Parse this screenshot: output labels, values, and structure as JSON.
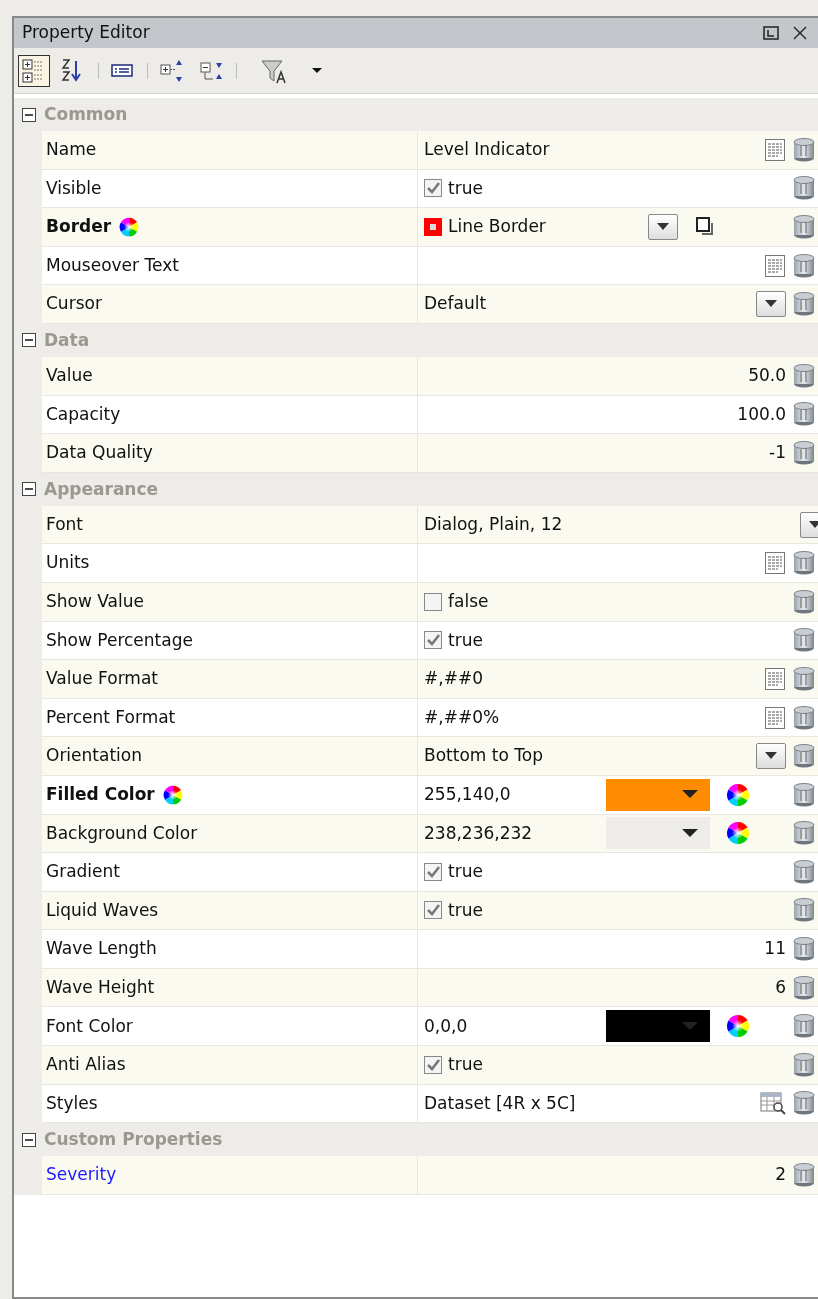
{
  "window": {
    "title": "Property Editor"
  },
  "toolbar": [
    {
      "kind": "categorized",
      "selected": true
    },
    {
      "kind": "sort",
      "selected": false
    },
    {
      "kind": "sep"
    },
    {
      "kind": "description",
      "selected": false
    },
    {
      "kind": "sep"
    },
    {
      "kind": "expand",
      "selected": false
    },
    {
      "kind": "collapse",
      "selected": false
    },
    {
      "kind": "sep"
    },
    {
      "kind": "filter",
      "selected": false
    },
    {
      "kind": "caret",
      "selected": false
    }
  ],
  "sections": [
    {
      "title": "Common",
      "expanded": true,
      "rows": [
        {
          "name": "Name",
          "kind": "text",
          "value": "Level Indicator",
          "editor": true,
          "binding": true
        },
        {
          "name": "Visible",
          "kind": "check",
          "checked": true,
          "value": "true",
          "binding": true
        },
        {
          "name": "Border",
          "kind": "border",
          "value": "Line Border",
          "bound": true,
          "binding": true
        },
        {
          "name": "Mouseover Text",
          "kind": "text",
          "editor": true,
          "binding": true
        },
        {
          "name": "Cursor",
          "kind": "dropdown",
          "value": "Default",
          "binding": true
        }
      ]
    },
    {
      "title": "Data",
      "expanded": true,
      "rows": [
        {
          "name": "Value",
          "kind": "number",
          "value": "50.0",
          "binding": true
        },
        {
          "name": "Capacity",
          "kind": "number",
          "value": "100.0",
          "binding": true
        },
        {
          "name": "Data Quality",
          "kind": "number",
          "value": "-1",
          "binding": true
        }
      ]
    },
    {
      "title": "Appearance",
      "expanded": true,
      "rows": [
        {
          "name": "Font",
          "kind": "dropdown",
          "value": "Dialog, Plain, 12",
          "binding": false
        },
        {
          "name": "Units",
          "kind": "text",
          "editor": true,
          "binding": true
        },
        {
          "name": "Show Value",
          "kind": "check",
          "checked": false,
          "value": "false",
          "binding": true
        },
        {
          "name": "Show Percentage",
          "kind": "check",
          "checked": true,
          "value": "true",
          "binding": true
        },
        {
          "name": "Value Format",
          "kind": "text",
          "value": "#,##0",
          "editor": true,
          "binding": true
        },
        {
          "name": "Percent Format",
          "kind": "text",
          "value": "#,##0%",
          "editor": true,
          "binding": true
        },
        {
          "name": "Orientation",
          "kind": "dropdown",
          "value": "Bottom to Top",
          "binding": true
        },
        {
          "name": "Filled Color",
          "kind": "color",
          "value": "255,140,0",
          "color": "#ff8c00",
          "bound": true,
          "binding": true
        },
        {
          "name": "Background Color",
          "kind": "color",
          "value": "238,236,232",
          "color": "#eeece8",
          "binding": true
        },
        {
          "name": "Gradient",
          "kind": "check",
          "checked": true,
          "value": "true",
          "binding": true
        },
        {
          "name": "Liquid Waves",
          "kind": "check",
          "checked": true,
          "value": "true",
          "binding": true
        },
        {
          "name": "Wave Length",
          "kind": "number",
          "value": "11",
          "binding": true
        },
        {
          "name": "Wave Height",
          "kind": "number",
          "value": "6",
          "binding": true
        },
        {
          "name": "Font Color",
          "kind": "color",
          "value": "0,0,0",
          "color": "#000000",
          "binding": true
        },
        {
          "name": "Anti Alias",
          "kind": "check",
          "checked": true,
          "value": "true",
          "binding": true
        },
        {
          "name": "Styles",
          "kind": "dataset",
          "value": "Dataset [4R x 5C]",
          "binding": true
        }
      ]
    },
    {
      "title": "Custom Properties",
      "expanded": true,
      "rows": [
        {
          "name": "Severity",
          "kind": "number",
          "value": "2",
          "custom": true,
          "binding": true
        }
      ]
    }
  ]
}
